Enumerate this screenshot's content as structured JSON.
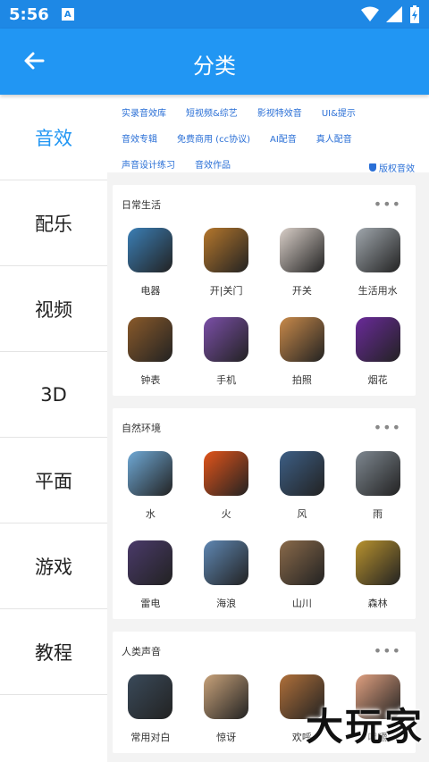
{
  "status_bar": {
    "time": "5:56",
    "notification_icon": "A"
  },
  "app_bar": {
    "title": "分类",
    "back_icon": "arrow-left-icon"
  },
  "sidebar": {
    "items": [
      {
        "label": "音效",
        "active": true
      },
      {
        "label": "配乐"
      },
      {
        "label": "视频"
      },
      {
        "label": "3D"
      },
      {
        "label": "平面"
      },
      {
        "label": "游戏"
      },
      {
        "label": "教程"
      }
    ]
  },
  "tags": {
    "row1": [
      "实录音效库",
      "短视频&综艺",
      "影视特效音",
      "UI&提示"
    ],
    "row2": [
      "音效专辑",
      "免费商用 (cc协议)",
      "AI配音",
      "真人配音"
    ],
    "row3": [
      "声音设计练习",
      "音效作品"
    ],
    "copyright": "版权音效"
  },
  "sections": [
    {
      "title": "日常生活",
      "items": [
        {
          "label": "电器",
          "color": "#3b7fb6"
        },
        {
          "label": "开|关门",
          "color": "#b5772c"
        },
        {
          "label": "开关",
          "color": "#d9cfc8"
        },
        {
          "label": "生活用水",
          "color": "#a0a7ad"
        },
        {
          "label": "钟表",
          "color": "#8a5a2a"
        },
        {
          "label": "手机",
          "color": "#7b4fa8"
        },
        {
          "label": "拍照",
          "color": "#c98a4a"
        },
        {
          "label": "烟花",
          "color": "#6a2a9a"
        }
      ]
    },
    {
      "title": "自然环境",
      "items": [
        {
          "label": "水",
          "color": "#6fa9d6"
        },
        {
          "label": "火",
          "color": "#e2541a"
        },
        {
          "label": "风",
          "color": "#3d5f86"
        },
        {
          "label": "雨",
          "color": "#7e8790"
        },
        {
          "label": "雷电",
          "color": "#4a3a6a"
        },
        {
          "label": "海浪",
          "color": "#5f87b3"
        },
        {
          "label": "山川",
          "color": "#8a6a4a"
        },
        {
          "label": "森林",
          "color": "#b8922e"
        }
      ]
    },
    {
      "title": "人类声音",
      "items": [
        {
          "label": "常用对白",
          "color": "#3a4a5a"
        },
        {
          "label": "惊讶",
          "color": "#c8a27a"
        },
        {
          "label": "欢呼",
          "color": "#b0703a"
        },
        {
          "label": "咀嚼",
          "color": "#e0a080"
        }
      ]
    }
  ],
  "watermark": "大玩家"
}
